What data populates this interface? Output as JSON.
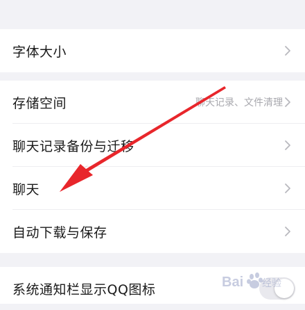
{
  "settings": {
    "font_size": {
      "label": "字体大小"
    },
    "storage": {
      "label": "存储空间",
      "sub": "聊天记录、文件清理"
    },
    "backup": {
      "label": "聊天记录备份与迁移"
    },
    "chat": {
      "label": "聊天"
    },
    "auto_download": {
      "label": "自动下载与保存"
    },
    "notify_icon": {
      "label": "系统通知栏显示QQ图标"
    }
  },
  "watermark": {
    "text": "Baidu经验"
  },
  "colors": {
    "background": "#f2f2f6",
    "row": "#ffffff",
    "text": "#1a1a1a",
    "subtext": "#a8a8ae",
    "chevron": "#b8b8be",
    "arrow": "#e8262b"
  }
}
